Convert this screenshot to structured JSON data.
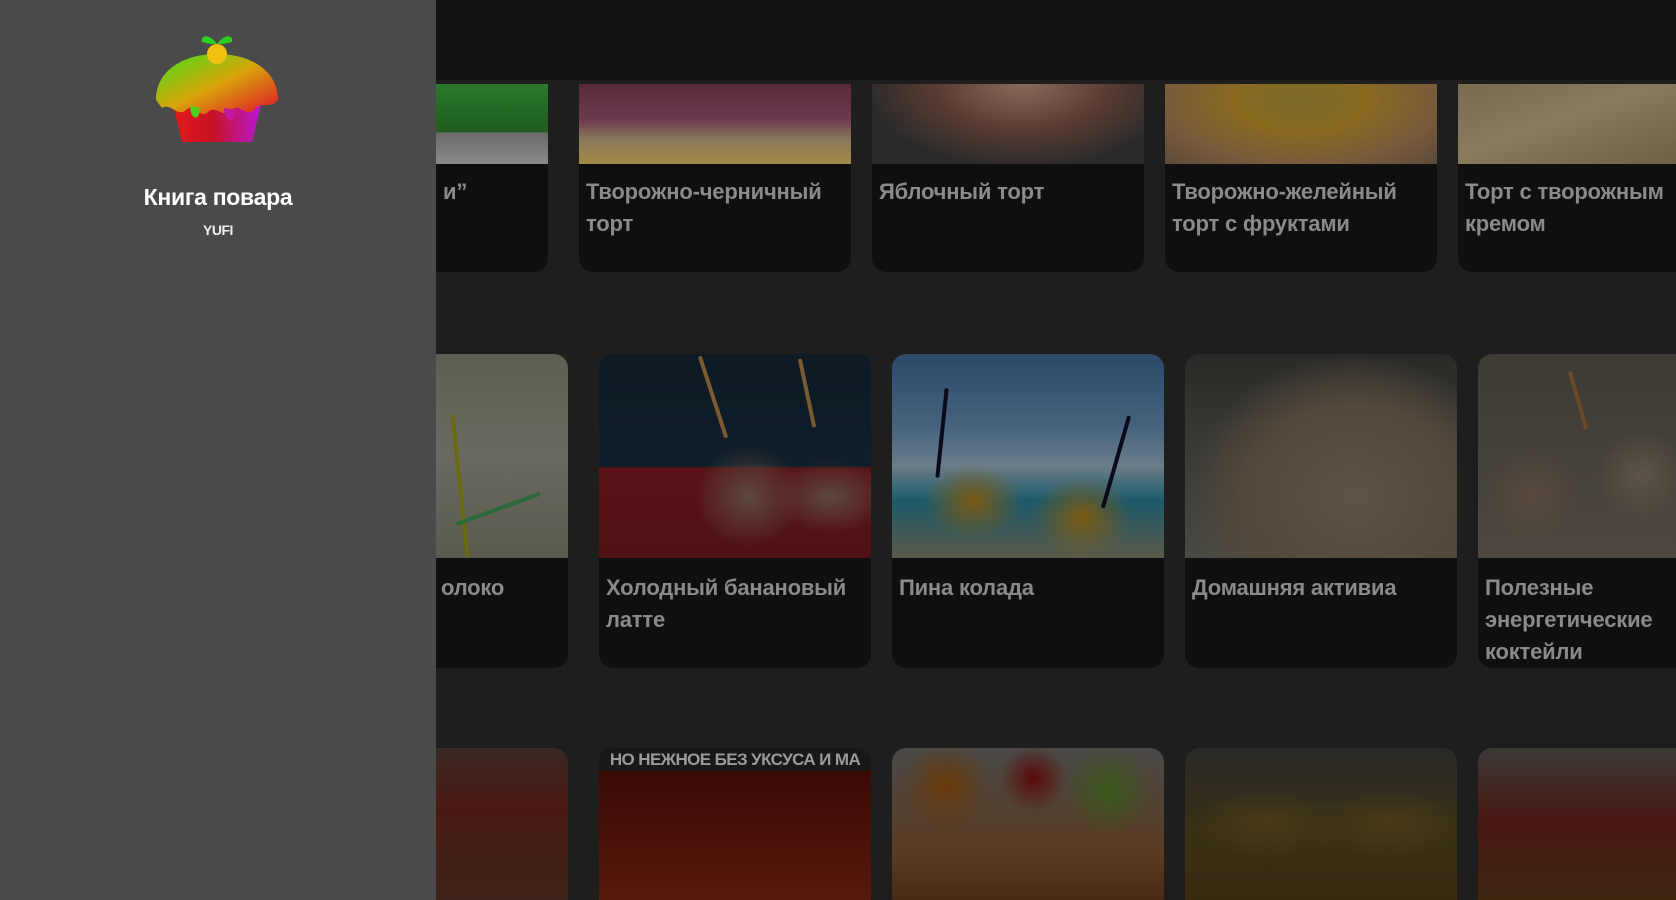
{
  "drawer": {
    "app_name": "Книга повара",
    "developer": "YUFI",
    "logo_icon": "cupcake-logo-icon"
  },
  "shelves": [
    {
      "cards": [
        {
          "title": "и”",
          "image": "green-jelly-cake"
        },
        {
          "title": "Творожно-черничный торт",
          "image": "blueberry-curd-cake"
        },
        {
          "title": "Яблочный торт",
          "image": "apple-cake"
        },
        {
          "title": "Творожно-желейный торт с фруктами",
          "image": "curd-jelly-fruit-cake"
        },
        {
          "title": "Торт с творожным кремом",
          "image": "curd-cream-cake"
        }
      ]
    },
    {
      "cards": [
        {
          "title": "олоко",
          "image": "milk-glass"
        },
        {
          "title": "Холодный банановый латте",
          "image": "banana-latte"
        },
        {
          "title": "Пина колада",
          "image": "pina-colada"
        },
        {
          "title": "Домашняя активиа",
          "image": "homemade-activia"
        },
        {
          "title": "Полезные энергетические коктейли",
          "image": "energy-shakes"
        }
      ]
    },
    {
      "cards": [
        {
          "image": "jars-preserves"
        },
        {
          "image": "tomato-sauce",
          "banner": "НО НЕЖНОЕ БЕЗ УКСУСА И МА"
        },
        {
          "image": "pepper-jars"
        },
        {
          "image": "vegetable-salad-jars"
        },
        {
          "image": "pickled-jars"
        }
      ]
    }
  ]
}
